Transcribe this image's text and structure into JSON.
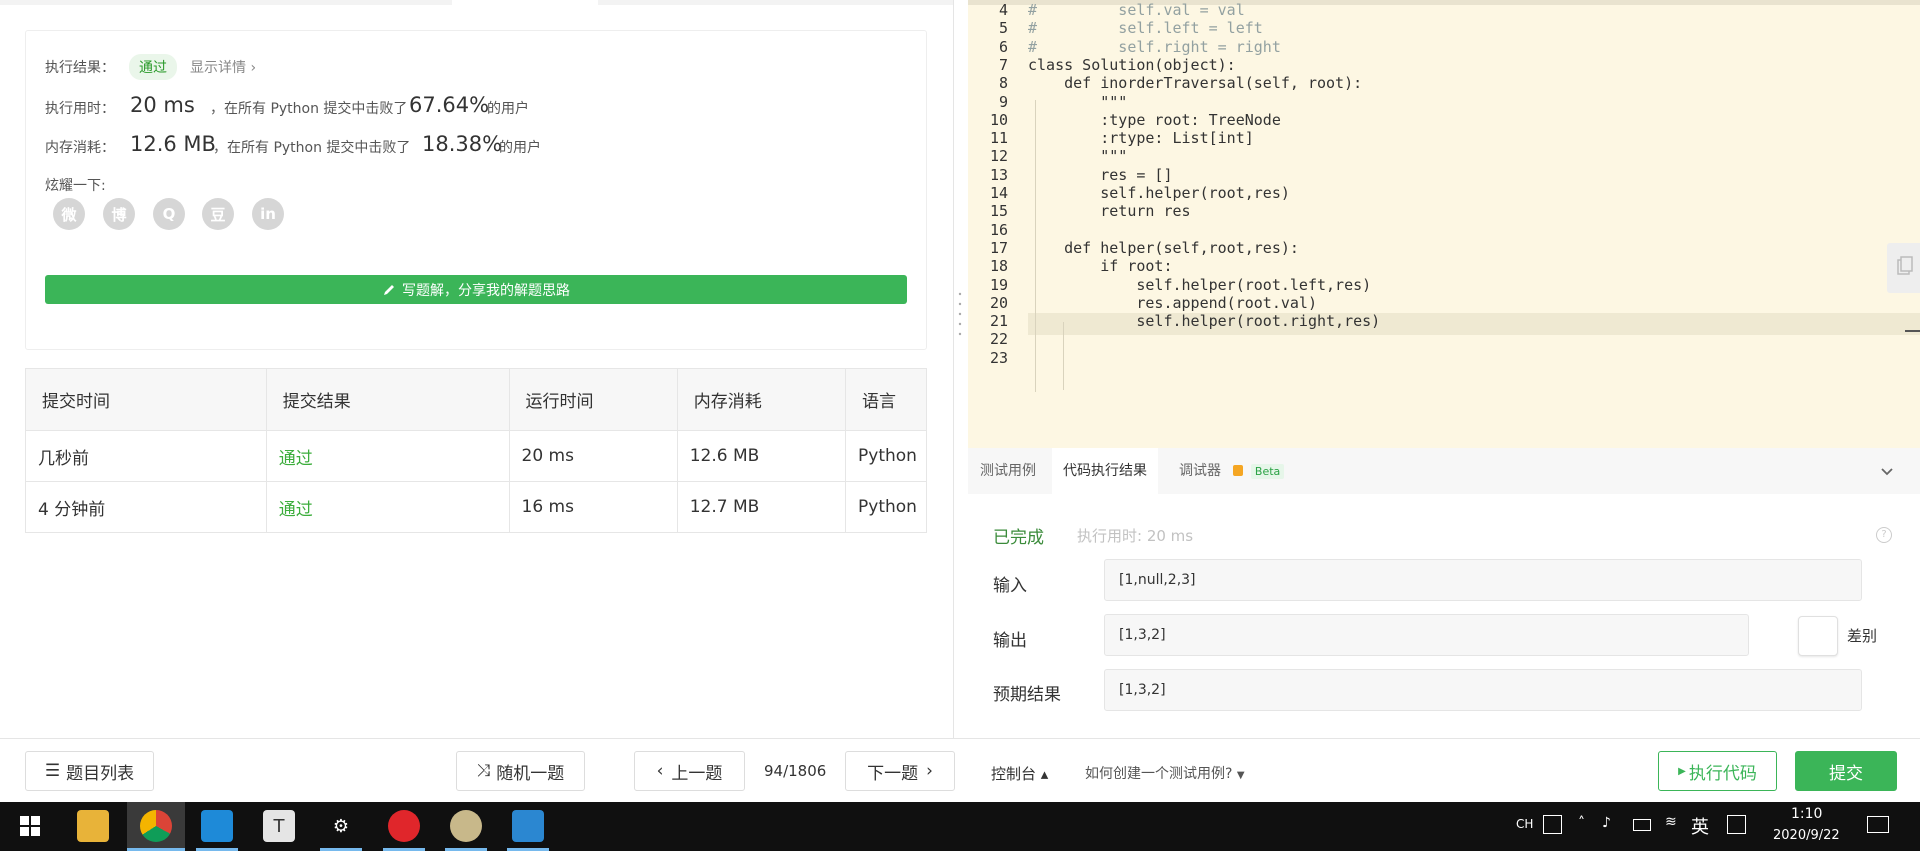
{
  "left": {
    "result": {
      "status_label": "执行结果：",
      "status_badge": "通过",
      "details_link": "显示详情 ›",
      "time_label": "执行用时：",
      "time_value": "20 ms",
      "time_mid": "，在所有 Python 提交中击败了",
      "time_pct": "67.64%",
      "time_tail": "的用户",
      "mem_label": "内存消耗：",
      "mem_value": "12.6 MB",
      "mem_mid": "，在所有 Python 提交中击败了",
      "mem_pct": "18.38%",
      "mem_tail": "的用户",
      "share_label": "炫耀一下:",
      "social": [
        "微",
        "博",
        "Q",
        "豆",
        "in"
      ],
      "share_button": "写题解，分享我的解题思路"
    },
    "submissions": {
      "headers": [
        "提交时间",
        "提交结果",
        "运行时间",
        "内存消耗",
        "语言"
      ],
      "rows": [
        [
          "几秒前",
          "通过",
          "20 ms",
          "12.6 MB",
          "Python"
        ],
        [
          "4 分钟前",
          "通过",
          "16 ms",
          "12.7 MB",
          "Python"
        ]
      ]
    }
  },
  "editor": {
    "lines": [
      {
        "n": "4",
        "text": "#         self.val = val"
      },
      {
        "n": "5",
        "text": "#         self.left = left"
      },
      {
        "n": "6",
        "text": "#         self.right = right"
      },
      {
        "n": "7",
        "text": "class Solution(object):"
      },
      {
        "n": "8",
        "text": "    def inorderTraversal(self, root):"
      },
      {
        "n": "9",
        "text": "        \"\"\""
      },
      {
        "n": "10",
        "text": "        :type root: TreeNode"
      },
      {
        "n": "11",
        "text": "        :rtype: List[int]"
      },
      {
        "n": "12",
        "text": "        \"\"\""
      },
      {
        "n": "13",
        "text": "        res = []"
      },
      {
        "n": "14",
        "text": "        self.helper(root,res)"
      },
      {
        "n": "15",
        "text": "        return res"
      },
      {
        "n": "16",
        "text": ""
      },
      {
        "n": "17",
        "text": "    def helper(self,root,res):"
      },
      {
        "n": "18",
        "text": "        if root:"
      },
      {
        "n": "19",
        "text": "            self.helper(root.left,res)"
      },
      {
        "n": "20",
        "text": "            res.append(root.val)"
      },
      {
        "n": "21",
        "text": "            self.helper(root.right,res)"
      },
      {
        "n": "22",
        "text": ""
      },
      {
        "n": "23",
        "text": ""
      }
    ]
  },
  "console": {
    "tabs": [
      "测试用例",
      "代码执行结果",
      "调试器"
    ],
    "beta": "Beta",
    "status": "已完成",
    "exec_time": "执行用时: 20 ms",
    "input_label": "输入",
    "input_value": "[1,null,2,3]",
    "output_label": "输出",
    "output_value": "[1,3,2]",
    "diff_label": "差别",
    "expected_label": "预期结果",
    "expected_value": "[1,3,2]"
  },
  "bottom": {
    "problem_list": "题目列表",
    "random": "随机一题",
    "prev": "上一题",
    "page": "94/1806",
    "next": "下一题",
    "console_toggle": "控制台 ▴",
    "howto": "如何创建一个测试用例?",
    "run": "执行代码",
    "submit": "提交"
  },
  "taskbar": {
    "ime1": "CH",
    "ime2": "英",
    "time": "1:10",
    "date": "2020/9/22"
  },
  "colors": {
    "accent_green": "#3bb558",
    "editor_bg": "#fdf7e3"
  }
}
